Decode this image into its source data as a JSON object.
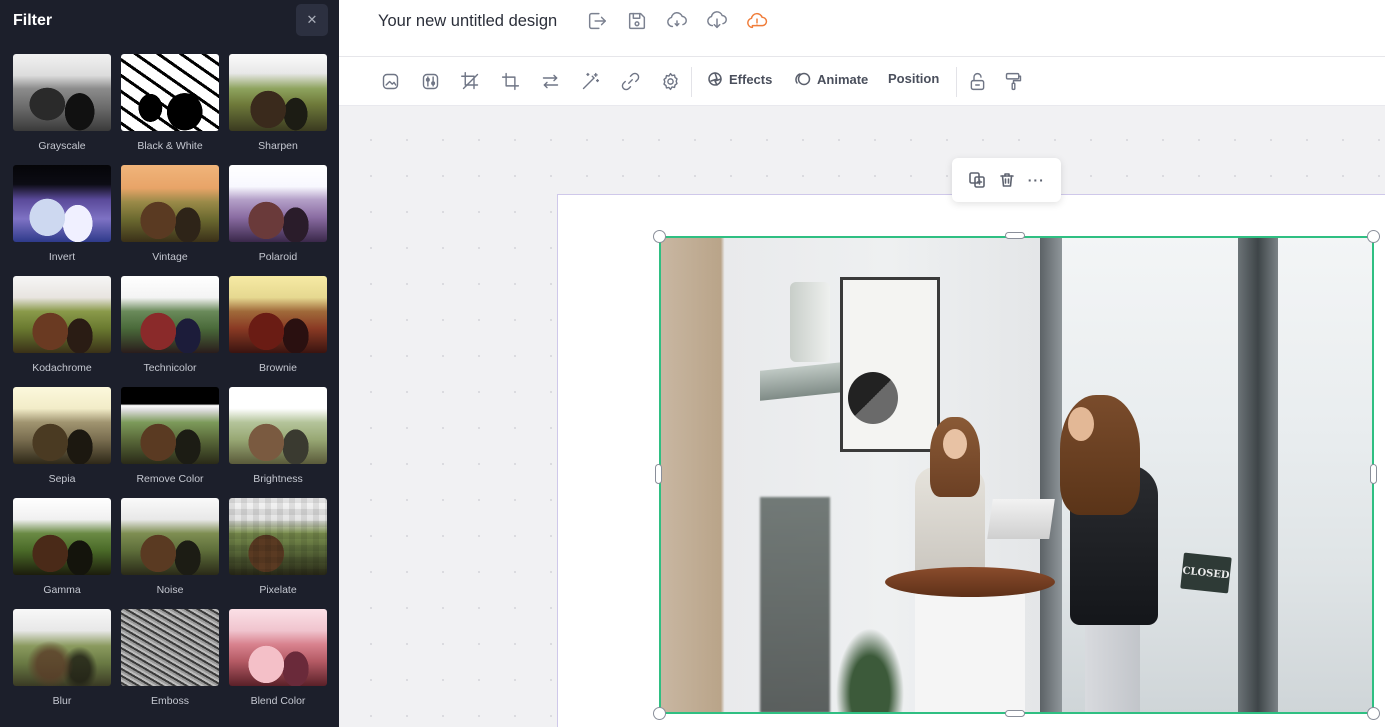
{
  "panel": {
    "title": "Filter",
    "close_icon": "close-icon",
    "filters": [
      {
        "label": "Grayscale",
        "key": "grayscale"
      },
      {
        "label": "Black & White",
        "key": "bw"
      },
      {
        "label": "Sharpen",
        "key": "sharpen"
      },
      {
        "label": "Invert",
        "key": "invert"
      },
      {
        "label": "Vintage",
        "key": "vintage"
      },
      {
        "label": "Polaroid",
        "key": "polaroid"
      },
      {
        "label": "Kodachrome",
        "key": "kodachrome"
      },
      {
        "label": "Technicolor",
        "key": "technicolor"
      },
      {
        "label": "Brownie",
        "key": "brownie"
      },
      {
        "label": "Sepia",
        "key": "sepia"
      },
      {
        "label": "Remove Color",
        "key": "removecolor"
      },
      {
        "label": "Brightness",
        "key": "brightness"
      },
      {
        "label": "Gamma",
        "key": "gamma"
      },
      {
        "label": "Noise",
        "key": "noise"
      },
      {
        "label": "Pixelate",
        "key": "pixelate"
      },
      {
        "label": "Blur",
        "key": "blur"
      },
      {
        "label": "Emboss",
        "key": "emboss"
      },
      {
        "label": "Blend Color",
        "key": "blendcolor"
      }
    ]
  },
  "header": {
    "doc_title": "Your new untitled design",
    "icons": [
      "export-icon",
      "save-icon",
      "sync-icon",
      "download-icon",
      "cloud-warning-icon"
    ]
  },
  "toolbar": {
    "icons": [
      "replace-image-icon",
      "adjust-icon",
      "crop-icon",
      "resize-icon",
      "flip-icon",
      "magic-wand-icon",
      "link-icon",
      "settings-icon"
    ],
    "effects_label": "Effects",
    "animate_label": "Animate",
    "position_label": "Position",
    "right_icons": [
      "lock-icon",
      "paint-roller-icon"
    ]
  },
  "canvas": {
    "sign_text": "CLOSED"
  },
  "mini_toolbar": {
    "icons": [
      "duplicate-icon",
      "delete-icon"
    ],
    "more_label": "···"
  },
  "colors": {
    "panel_bg": "#1c1f2b",
    "selection": "#2fbf82",
    "warning": "#f07d3a",
    "artboard_border": "#cfc8ea"
  }
}
